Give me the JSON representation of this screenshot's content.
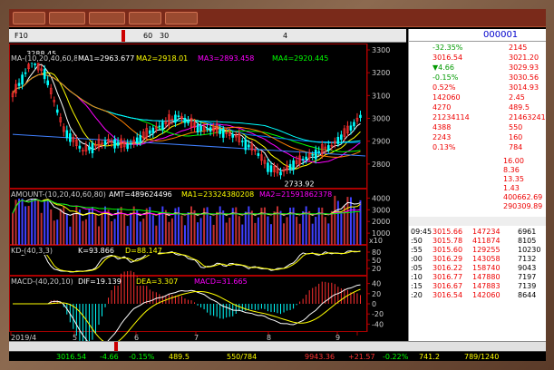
{
  "toolbar": {
    "items": [
      "F10",
      "",
      "",
      "",
      "",
      "",
      "60",
      "30",
      "",
      "",
      "",
      "",
      "",
      "4",
      "",
      "",
      "",
      ""
    ],
    "selected_index": 5
  },
  "chart": {
    "main_legend": [
      "MA-(10,20,40,60,80,160,320,5)",
      "MA1=2963.677",
      "MA2=2918.01",
      "MA3=2893.458",
      "MA4=2920.445"
    ],
    "high_label": "3288.45",
    "low_label": "2733.92",
    "price_ticks": [
      "3300",
      "3200",
      "3100",
      "3000",
      "2900",
      "2800"
    ],
    "amount_legend": [
      "AMOUNT-(10,20,40,60,80)",
      "AMT=489624496",
      "MA1=23324380208",
      "MA2=21591862378"
    ],
    "amount_ticks": [
      "4000",
      "3000",
      "2000",
      "1000"
    ],
    "amount_unit": "x10",
    "kd_legend": [
      "KD-(40,3,3)",
      "K=93.866",
      "D=88.147"
    ],
    "kd_ticks": [
      "80",
      "50",
      "20"
    ],
    "macd_legend": [
      "MACD-(40,20,10)",
      "DIF=19.139",
      "DEA=3.307",
      "MACD=31.665"
    ],
    "macd_ticks": [
      "40",
      "20",
      "0",
      "-20",
      "-40"
    ],
    "x_labels": [
      "2019/4",
      "5",
      "6",
      "7",
      "8",
      "9",
      ""
    ]
  },
  "colors": {
    "ma1": "#ffffff",
    "ma2": "#ffff00",
    "ma3": "#ff00ff",
    "ma4": "#00ff00",
    "ma5": "#0080ff",
    "ma6": "#c0c0c0",
    "ma7": "#ff8000",
    "ma8": "#00ffff",
    "up": "#ff3030",
    "down": "#00ffff",
    "bg": "#000000"
  },
  "panel": {
    "title": "",
    "code": "000001",
    "rows": [
      [
        "",
        "-32.35%",
        "",
        "2145"
      ],
      [
        "",
        "3016.54",
        "",
        "3021.20"
      ],
      [
        "",
        "▼4.66",
        "",
        "3029.93"
      ],
      [
        "",
        "-0.15%",
        "",
        "3030.56"
      ],
      [
        "",
        "0.52%",
        "",
        "3014.93"
      ],
      [
        "",
        "142060",
        "",
        "2.45"
      ],
      [
        "",
        "4270",
        "",
        "489.5"
      ],
      [
        "",
        "21234114",
        "",
        "21463241"
      ],
      [
        "",
        "4388",
        "",
        "550"
      ],
      [
        "",
        "2243",
        "",
        "160"
      ],
      [
        "",
        "0.13%",
        "",
        "784"
      ],
      [
        "",
        "",
        "",
        "16.00"
      ],
      [
        "",
        "",
        "",
        "8.36"
      ],
      [
        "",
        "",
        "",
        "13.35"
      ],
      [
        "",
        "",
        "",
        "1.43"
      ],
      [
        "",
        "",
        "",
        "400662.69"
      ],
      [
        "",
        "",
        "",
        "290309.89"
      ]
    ],
    "trades_header": [
      "",
      "",
      "",
      ""
    ],
    "trades": [
      [
        "09:45",
        "3015.66",
        "147234",
        "6961"
      ],
      [
        ":50",
        "3015.78",
        "411874",
        "8105"
      ],
      [
        ":55",
        "3015.60",
        "129255",
        "10230"
      ],
      [
        ":00",
        "3016.29",
        "143058",
        "7132"
      ],
      [
        ":05",
        "3016.22",
        "158740",
        "9043"
      ],
      [
        ":10",
        "3016.77",
        "147880",
        "7197"
      ],
      [
        ":15",
        "3016.67",
        "147883",
        "7139"
      ],
      [
        ":20",
        "3016.54",
        "142060",
        "8644"
      ]
    ]
  },
  "bottom_tabs": [
    "",
    "",
    "",
    "",
    "",
    "",
    "",
    "",
    "",
    "",
    "",
    "",
    ""
  ],
  "status": {
    "name": "",
    "index": "3016.54",
    "change": "-4.66",
    "pct": "-0.15%",
    "amount": "489.5",
    "ratio": "550/784",
    "name2": "",
    "index2": "9943.36",
    "change2": "+21.57",
    "pct2": "-0.22%",
    "amount2": "741.2",
    "ratio2": "789/1240",
    "conn": ""
  }
}
